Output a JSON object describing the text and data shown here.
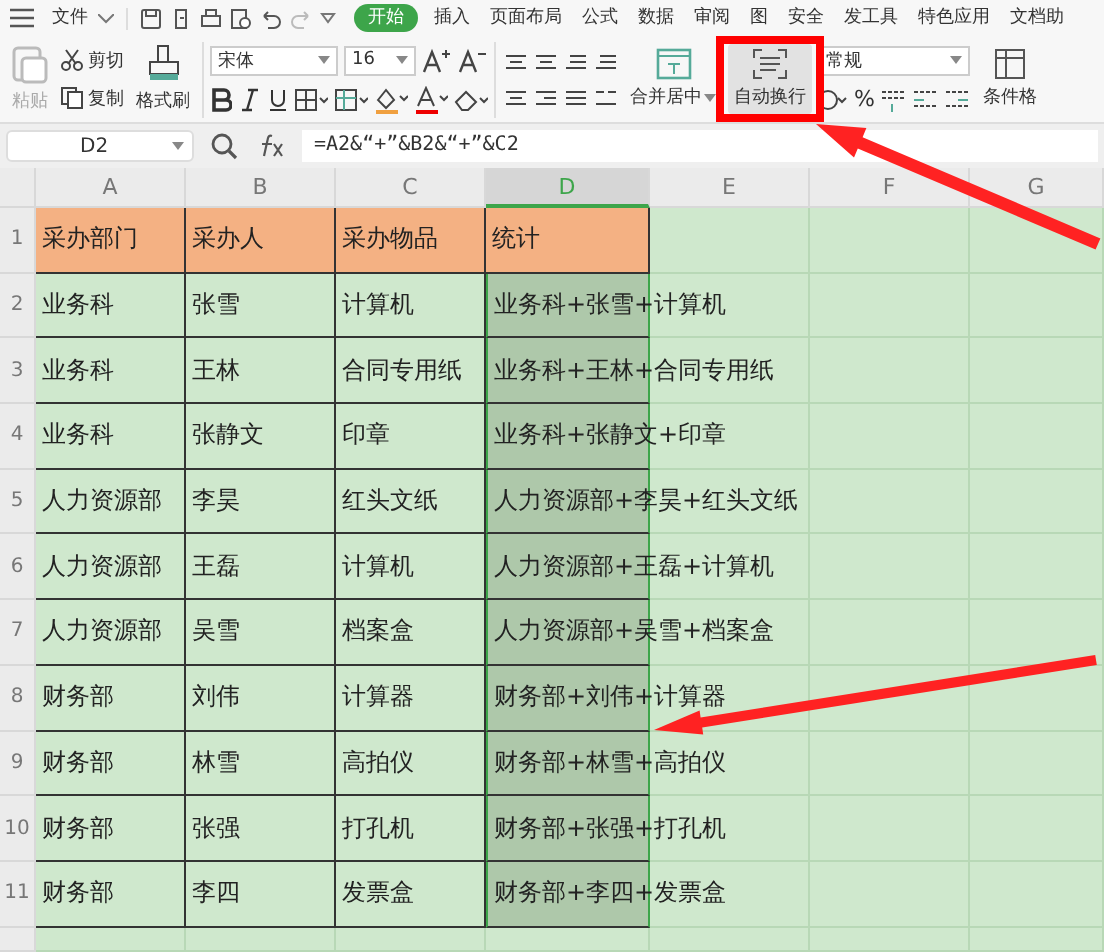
{
  "ribbon": {
    "tabs": [
      {
        "label": "文件",
        "selected": false
      },
      {
        "label": "开始",
        "selected": true
      },
      {
        "label": "插入",
        "selected": false
      },
      {
        "label": "页面布局",
        "selected": false
      },
      {
        "label": "公式",
        "selected": false
      },
      {
        "label": "数据",
        "selected": false
      },
      {
        "label": "审阅",
        "selected": false
      },
      {
        "label": "图",
        "selected": false
      },
      {
        "label": "安全",
        "selected": false
      },
      {
        "label": "发工具",
        "selected": false
      },
      {
        "label": "特色应用",
        "selected": false
      },
      {
        "label": "文档助",
        "selected": false
      }
    ],
    "paste": "粘贴",
    "cut": "剪切",
    "copy": "复制",
    "format_painter": "格式刷",
    "font": {
      "name": "宋体",
      "size": "16"
    },
    "merge": "合并居中",
    "wrap": {
      "label": "自动换行",
      "selected": true
    },
    "number_format": "常规",
    "percent": "%",
    "conditional": "条件格"
  },
  "formula_bar": {
    "cell": "D2",
    "formula": "=A2&“+”&B2&“+”&C2"
  },
  "sheet": {
    "columns": [
      {
        "label": "A",
        "selected": false
      },
      {
        "label": "B",
        "selected": false
      },
      {
        "label": "C",
        "selected": false
      },
      {
        "label": "D",
        "selected": true
      },
      {
        "label": "E",
        "selected": false
      },
      {
        "label": "F",
        "selected": false
      },
      {
        "label": "G",
        "selected": false
      }
    ],
    "rows": [
      {
        "number": "1",
        "cells": [
          "采办部门",
          "采办人",
          "采办物品",
          "统计"
        ]
      },
      {
        "number": "2",
        "cells": [
          "业务科",
          "张雪",
          "计算机",
          "业务科+张雪+计算机"
        ]
      },
      {
        "number": "3",
        "cells": [
          "业务科",
          "王林",
          "合同专用纸",
          "业务科+王林+合同专用纸"
        ]
      },
      {
        "number": "4",
        "cells": [
          "业务科",
          "张静文",
          "印章",
          "业务科+张静文+印章"
        ]
      },
      {
        "number": "5",
        "cells": [
          "人力资源部",
          "李昊",
          "红头文纸",
          "人力资源部+李昊+红头文纸"
        ]
      },
      {
        "number": "6",
        "cells": [
          "人力资源部",
          "王磊",
          "计算机",
          "人力资源部+王磊+计算机"
        ]
      },
      {
        "number": "7",
        "cells": [
          "人力资源部",
          "吴雪",
          "档案盒",
          "人力资源部+吴雪+档案盒"
        ]
      },
      {
        "number": "8",
        "cells": [
          "财务部",
          "刘伟",
          "计算器",
          "财务部+刘伟+计算器"
        ]
      },
      {
        "number": "9",
        "cells": [
          "财务部",
          "林雪",
          "高拍仪",
          "财务部+林雪+高拍仪"
        ]
      },
      {
        "number": "10",
        "cells": [
          "财务部",
          "张强",
          "打孔机",
          "财务部+张强+打孔机"
        ]
      },
      {
        "number": "11",
        "cells": [
          "财务部",
          "李四",
          "发票盒",
          "财务部+李四+发票盒"
        ]
      }
    ]
  }
}
